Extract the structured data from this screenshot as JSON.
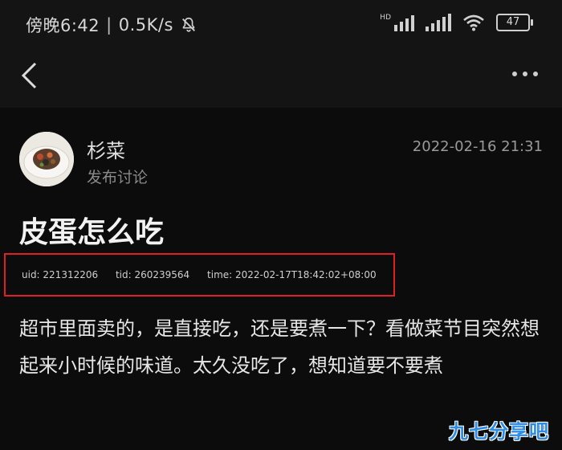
{
  "status_bar": {
    "time": "傍晚6:42",
    "speed": "0.5K/s",
    "network_label": "HD",
    "battery": "47"
  },
  "post": {
    "author": "杉菜",
    "action": "发布讨论",
    "timestamp": "2022-02-16 21:31",
    "title": "皮蛋怎么吃",
    "meta": {
      "uid": "uid: 221312206",
      "tid": "tid: 260239564",
      "time": "time: 2022-02-17T18:42:02+08:00"
    },
    "body": "超市里面卖的，是直接吃，还是要煮一下？看做菜节目突然想起来小时候的味道。太久没吃了，想知道要不要煮"
  },
  "watermark": "九七分享吧",
  "colors": {
    "background": "#0c0c0c",
    "highlight_box": "#e01e26",
    "watermark": "#2e8be6"
  }
}
